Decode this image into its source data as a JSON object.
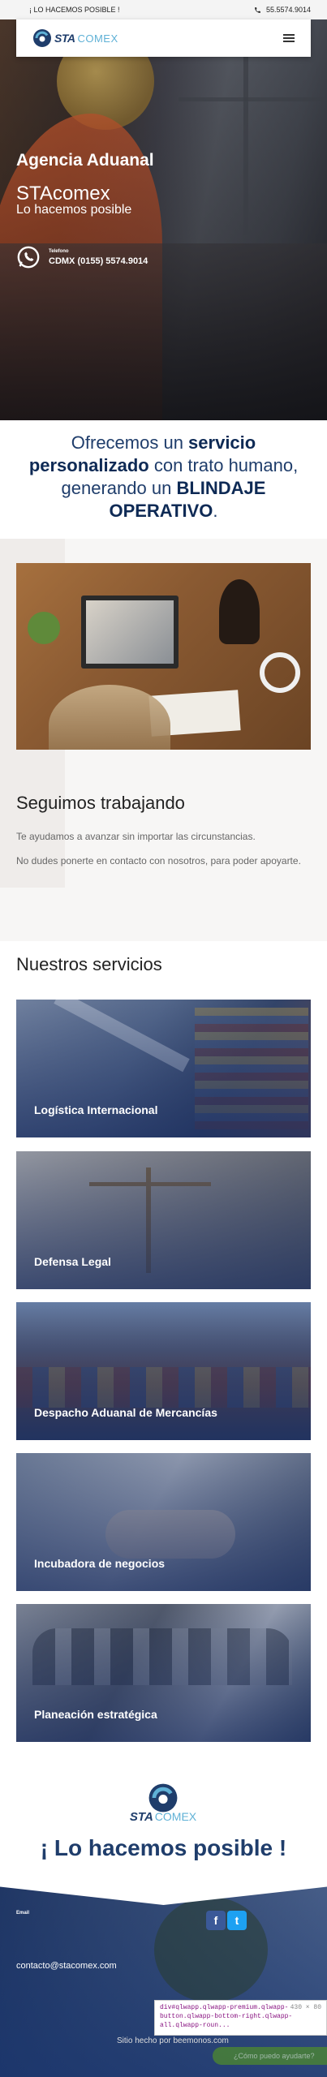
{
  "topbar": {
    "slogan": "¡ LO HACEMOS POSIBLE !",
    "phone": "55.5574.9014"
  },
  "nav": {
    "logo_sta": "STA",
    "logo_comex": "COMEX"
  },
  "hero": {
    "title": "Agencia Aduanal",
    "brand": "STAcomex",
    "tagline": "Lo hacemos posible",
    "contact_label": "Telefono",
    "contact_number": "CDMX (0155) 5574.9014"
  },
  "offer": {
    "p1": "Ofrecemos un ",
    "b1": "servicio personalizado",
    "p2": " con trato humano, generando un ",
    "b2": "BLINDAJE OPERATIVO",
    "p3": "."
  },
  "seguimos": {
    "title": "Seguimos trabajando",
    "p1": "Te ayudamos a avanzar sin importar las circunstancias.",
    "p2": "No dudes ponerte en contacto con nosotros, para poder apoyarte."
  },
  "services": {
    "title": "Nuestros servicios",
    "items": [
      "Logística Internacional",
      "Defensa Legal",
      "Despacho Aduanal de Mercancías",
      "Incubadora de negocios",
      "Planeación estratégica"
    ]
  },
  "footer": {
    "logo_sta": "STA",
    "logo_comex": "COMEX",
    "slogan": "¡ Lo hacemos posible !",
    "email_label": "Email",
    "email": "contacto@stacomex.com",
    "facebook": "f",
    "twitter": "t",
    "made_by_prefix": "Sitio hecho por ",
    "made_by_link": "beemonos.com"
  },
  "inspector": {
    "selector": "div#qlwapp.qlwapp-premium.qlwapp-button.qlwapp-bottom-right.qlwapp-all.qlwapp-roun...",
    "size": "430 × 80"
  },
  "help_button": "¿Cómo puedo ayudarte?",
  "colors": {
    "primary": "#1f3d6b",
    "accent": "#5fb1d6",
    "overlay": "#1c3062"
  }
}
